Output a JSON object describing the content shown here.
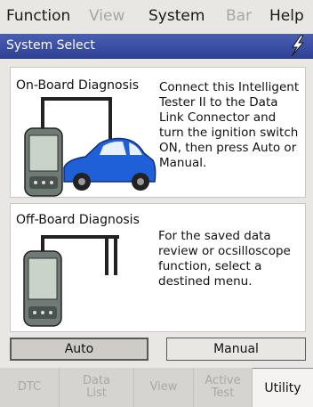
{
  "menubar": {
    "items": [
      {
        "label": "Function",
        "enabled": true
      },
      {
        "label": "View",
        "enabled": false
      },
      {
        "label": "System",
        "enabled": true
      },
      {
        "label": "Bar",
        "enabled": false
      },
      {
        "label": "Help",
        "enabled": true
      }
    ]
  },
  "titlebar": {
    "title": "System Select",
    "icon": "lightning-bolt-icon",
    "accent_color": "#3a4ea3"
  },
  "onboard": {
    "heading": "On-Board Diagnosis",
    "description": "Connect this Intelligent Tester II to the Data Link Connector and turn the ignition switch ON, then press Auto or Manual.",
    "illustration": "tester-connected-to-car-illustration",
    "car_color": "#1f5fd8"
  },
  "offboard": {
    "heading": "Off-Board Diagnosis",
    "description": "For the saved data review or ocsilloscope function, select a destined menu.",
    "illustration": "tester-with-probes-illustration"
  },
  "buttons": {
    "auto": {
      "label": "Auto",
      "selected": true
    },
    "manual": {
      "label": "Manual",
      "selected": false
    }
  },
  "tabs": [
    {
      "label": "DTC",
      "enabled": false
    },
    {
      "label": "Data List",
      "enabled": false
    },
    {
      "label": "View",
      "enabled": false
    },
    {
      "label": "Active Test",
      "enabled": false
    },
    {
      "label": "Utility",
      "enabled": true,
      "active": true
    }
  ]
}
